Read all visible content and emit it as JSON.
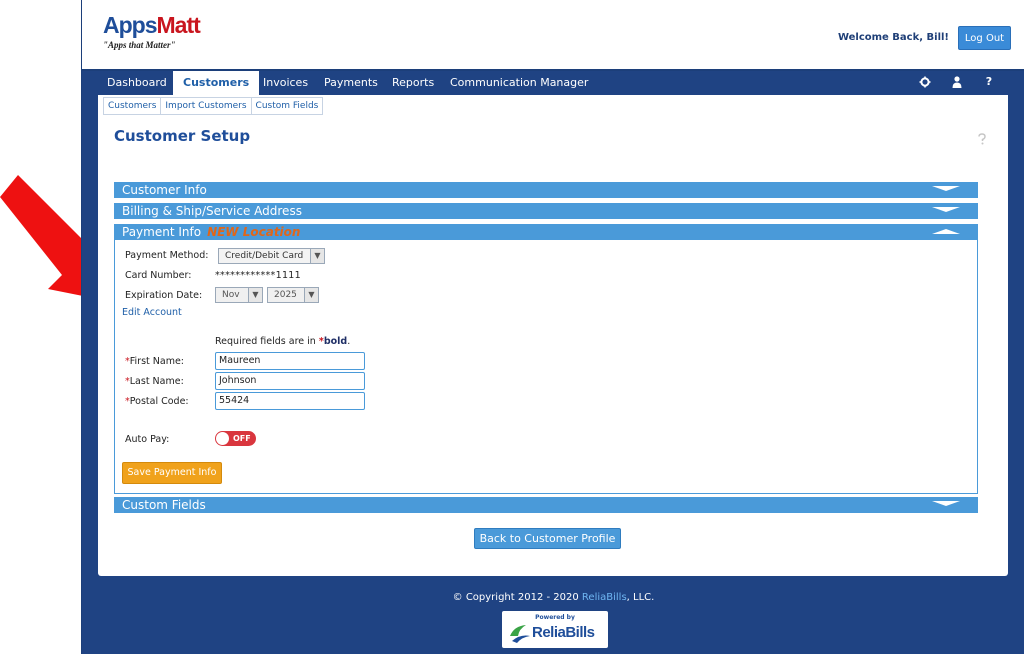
{
  "header": {
    "logo_part1": "Apps",
    "logo_part2": "Matt",
    "tagline": "\"Apps that Matter\"",
    "welcome": "Welcome Back, Bill!",
    "logout_label": "Log Out"
  },
  "nav": {
    "items": [
      "Dashboard",
      "Customers",
      "Invoices",
      "Payments",
      "Reports",
      "Communication Manager"
    ],
    "active": "Customers",
    "icons": [
      "gear-icon",
      "user-icon",
      "help-icon"
    ],
    "help_glyph": "?"
  },
  "subnav": [
    "Customers",
    "Import Customers",
    "Custom Fields"
  ],
  "page": {
    "title": "Customer Setup"
  },
  "sections": {
    "customer_info": "Customer Info",
    "billing": "Billing & Ship/Service Address",
    "payment_info": "Payment Info",
    "payment_badge": "NEW Location",
    "custom_fields": "Custom Fields"
  },
  "payment": {
    "method_label": "Payment Method:",
    "method_value": "Credit/Debit Card",
    "card_label": "Card Number:",
    "card_value": "************1111",
    "exp_label": "Expiration Date:",
    "exp_month": "Nov",
    "exp_year": "2025",
    "edit_link": "Edit Account",
    "required_note_prefix": "Required fields are in",
    "required_note_star": "*",
    "required_note_bold": "bold",
    "required_note_suffix": ".",
    "first_name_label": "First Name:",
    "first_name_value": "Maureen",
    "last_name_label": "Last Name:",
    "last_name_value": "Johnson",
    "postal_label": "Postal Code:",
    "postal_value": "55424",
    "required_star": "*",
    "autopay_label": "Auto Pay:",
    "autopay_state": "OFF",
    "save_label": "Save Payment Info"
  },
  "back_label": "Back to Customer Profile",
  "footer": {
    "copyright_prefix": "© Copyright 2012 - 2020",
    "copyright_brand": "ReliaBills",
    "copyright_suffix": ", LLC.",
    "logo_powered": "Powered by",
    "logo_name": "ReliaBills"
  },
  "colors": {
    "nav_bg": "#1f4383",
    "section_bar": "#4a9ad9",
    "save_button": "#f0a21c",
    "toggle_off": "#d9363e",
    "annotation_arrow": "#ee1111"
  }
}
